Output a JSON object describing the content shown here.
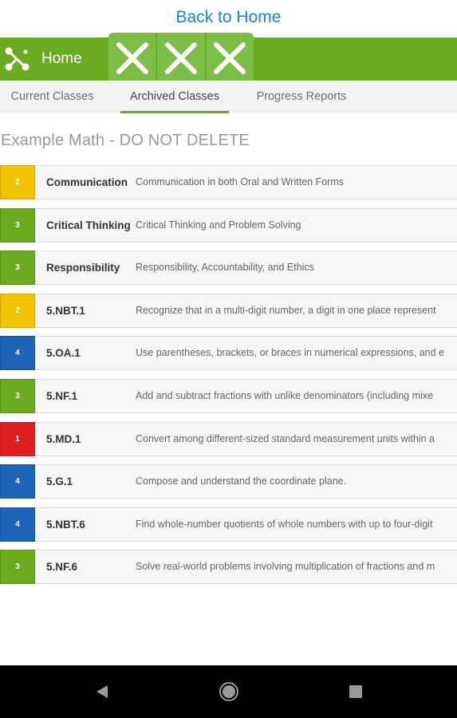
{
  "back_link": "Back to Home",
  "header": {
    "title": "Home",
    "logo_icon": "network-share-icon",
    "accent": "#6aab1f",
    "close_buttons": [
      "close-icon",
      "close-icon",
      "close-icon"
    ]
  },
  "tabs": [
    {
      "label": "Current Classes",
      "active": false
    },
    {
      "label": "Archived Classes",
      "active": true
    },
    {
      "label": "Progress Reports",
      "active": false
    }
  ],
  "class_title": "Example Math - DO NOT DELETE",
  "score_colors": {
    "1": "#e02020",
    "2": "#f2c400",
    "3": "#6aab1f",
    "4": "#1d63b8"
  },
  "standards": [
    {
      "score": "2",
      "code": "Communication",
      "description": "Communication in both Oral and Written Forms"
    },
    {
      "score": "3",
      "code": "Critical Thinking",
      "description": "Critical Thinking and Problem Solving"
    },
    {
      "score": "3",
      "code": "Responsibility",
      "description": "Responsibility, Accountability, and Ethics"
    },
    {
      "score": "2",
      "code": "5.NBT.1",
      "description": "Recognize that in a multi-digit number, a digit in one place represent"
    },
    {
      "score": "4",
      "code": "5.OA.1",
      "description": "Use parentheses, brackets, or braces in numerical expressions, and e"
    },
    {
      "score": "3",
      "code": "5.NF.1",
      "description": "Add and subtract fractions with unlike denominators (including mixe"
    },
    {
      "score": "1",
      "code": "5.MD.1",
      "description": "Convert among different-sized standard measurement units within a"
    },
    {
      "score": "4",
      "code": "5.G.1",
      "description": "Compose and understand the coordinate plane."
    },
    {
      "score": "4",
      "code": "5.NBT.6",
      "description": "Find whole-number quotients of whole numbers with up to four-digit"
    },
    {
      "score": "3",
      "code": "5.NF.6",
      "description": "Solve real-world problems involving multiplication of fractions and m"
    }
  ],
  "nav": [
    "back-triangle-icon",
    "home-circle-icon",
    "recents-square-icon"
  ]
}
